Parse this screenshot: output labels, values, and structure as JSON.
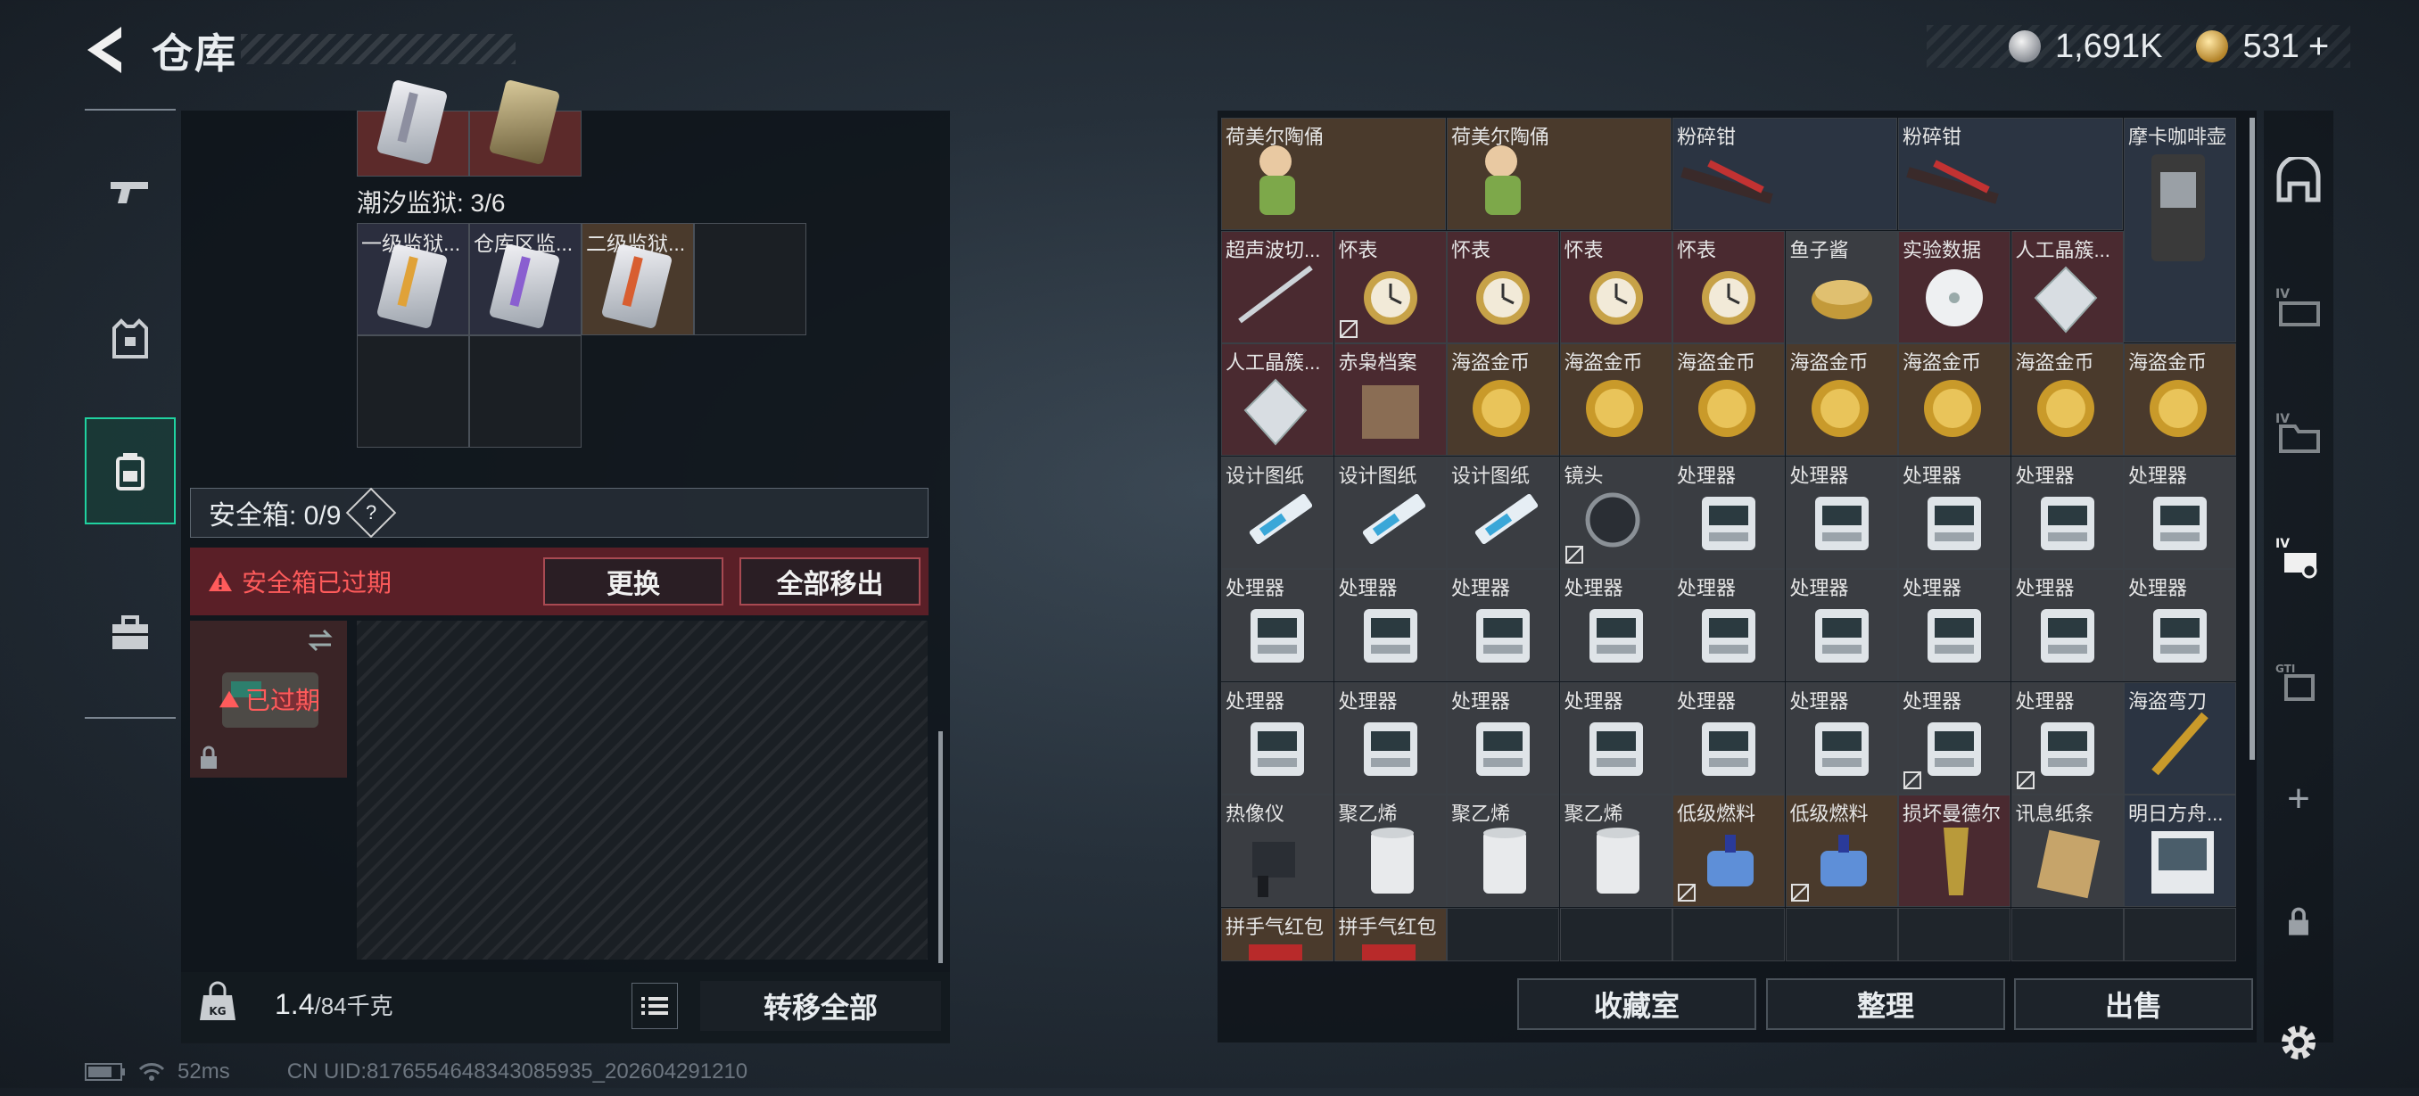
{
  "header": {
    "title": "仓库",
    "silver": "1,691K",
    "gold": "531"
  },
  "left": {
    "tide_label": "潮汐监狱: 3/6",
    "tide_cells": [
      "一级监狱...",
      "仓库区监...",
      "二级监狱..."
    ],
    "safe_title": "安全箱: 0/9",
    "help": "?",
    "expired_msg": "安全箱已过期",
    "btn_replace": "更换",
    "btn_move_all": "全部移出",
    "expired_badge": "已过期",
    "weight_value": "1.4",
    "weight_cap": "/84千克",
    "transfer_all": "转移全部"
  },
  "status": {
    "ping": "52ms",
    "uid": "CN UID:8176554648343085935_202604291210"
  },
  "items": [
    [
      "荷美尔陶俑",
      "荷美尔陶俑",
      "粉碎钳",
      "粉碎钳",
      "摩卡咖啡壶"
    ],
    [
      "超声波切...",
      "怀表",
      "怀表",
      "怀表",
      "怀表",
      "鱼子酱",
      "实验数据",
      "人工晶簇..."
    ],
    [
      "人工晶簇...",
      "赤枭档案",
      "海盗金币",
      "海盗金币",
      "海盗金币",
      "海盗金币",
      "海盗金币",
      "海盗金币",
      "海盗金币"
    ],
    [
      "设计图纸",
      "设计图纸",
      "设计图纸",
      "镜头",
      "处理器",
      "处理器",
      "处理器",
      "处理器",
      "处理器"
    ],
    [
      "处理器",
      "处理器",
      "处理器",
      "处理器",
      "处理器",
      "处理器",
      "处理器",
      "处理器",
      "处理器"
    ],
    [
      "处理器",
      "处理器",
      "处理器",
      "处理器",
      "处理器",
      "处理器",
      "处理器",
      "处理器",
      "海盗弯刀"
    ],
    [
      "热像仪",
      "聚乙烯",
      "聚乙烯",
      "聚乙烯",
      "低级燃料",
      "低级燃料",
      "损坏曼德尔",
      "讯息纸条",
      "明日方舟..."
    ],
    [
      "拼手气红包",
      "拼手气红包"
    ]
  ],
  "right_buttons": [
    "收藏室",
    "整理",
    "出售"
  ],
  "right_nav": [
    "+"
  ]
}
